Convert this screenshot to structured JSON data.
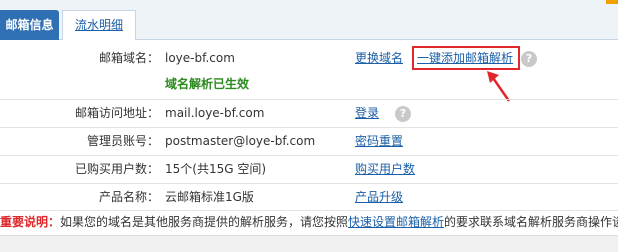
{
  "tabs": {
    "active": "邮箱信息",
    "inactive": "流水明细"
  },
  "domain": {
    "label": "邮箱域名：",
    "value": "loye-bf.com",
    "change_link": "更换域名",
    "quick_parse_link": "一键添加邮箱解析",
    "status": "域名解析已生效"
  },
  "access": {
    "label": "邮箱访问地址：",
    "value": "mail.loye-bf.com",
    "login_link": "登录"
  },
  "admin": {
    "label": "管理员账号：",
    "value": "postmaster@loye-bf.com",
    "reset_link": "密码重置"
  },
  "purchased": {
    "label": "已购买用户数：",
    "value": "15个(共15G 空间)",
    "buy_link": "购买用户数"
  },
  "product": {
    "label": "产品名称：",
    "value": "云邮箱标准1G版",
    "upgrade_link": "产品升级"
  },
  "note": {
    "label": "重要说明：",
    "text_before": "如果您的域名是其他服务商提供的解析服务，请您按照",
    "link": "快速设置邮箱解析",
    "text_after": "的要求联系域名解析服务商操作谈"
  },
  "help_icon": "?",
  "colors": {
    "accent": "#2f6fb3",
    "link": "#1a5fa8",
    "success": "#2c8a1f",
    "alert": "#e0282c"
  }
}
